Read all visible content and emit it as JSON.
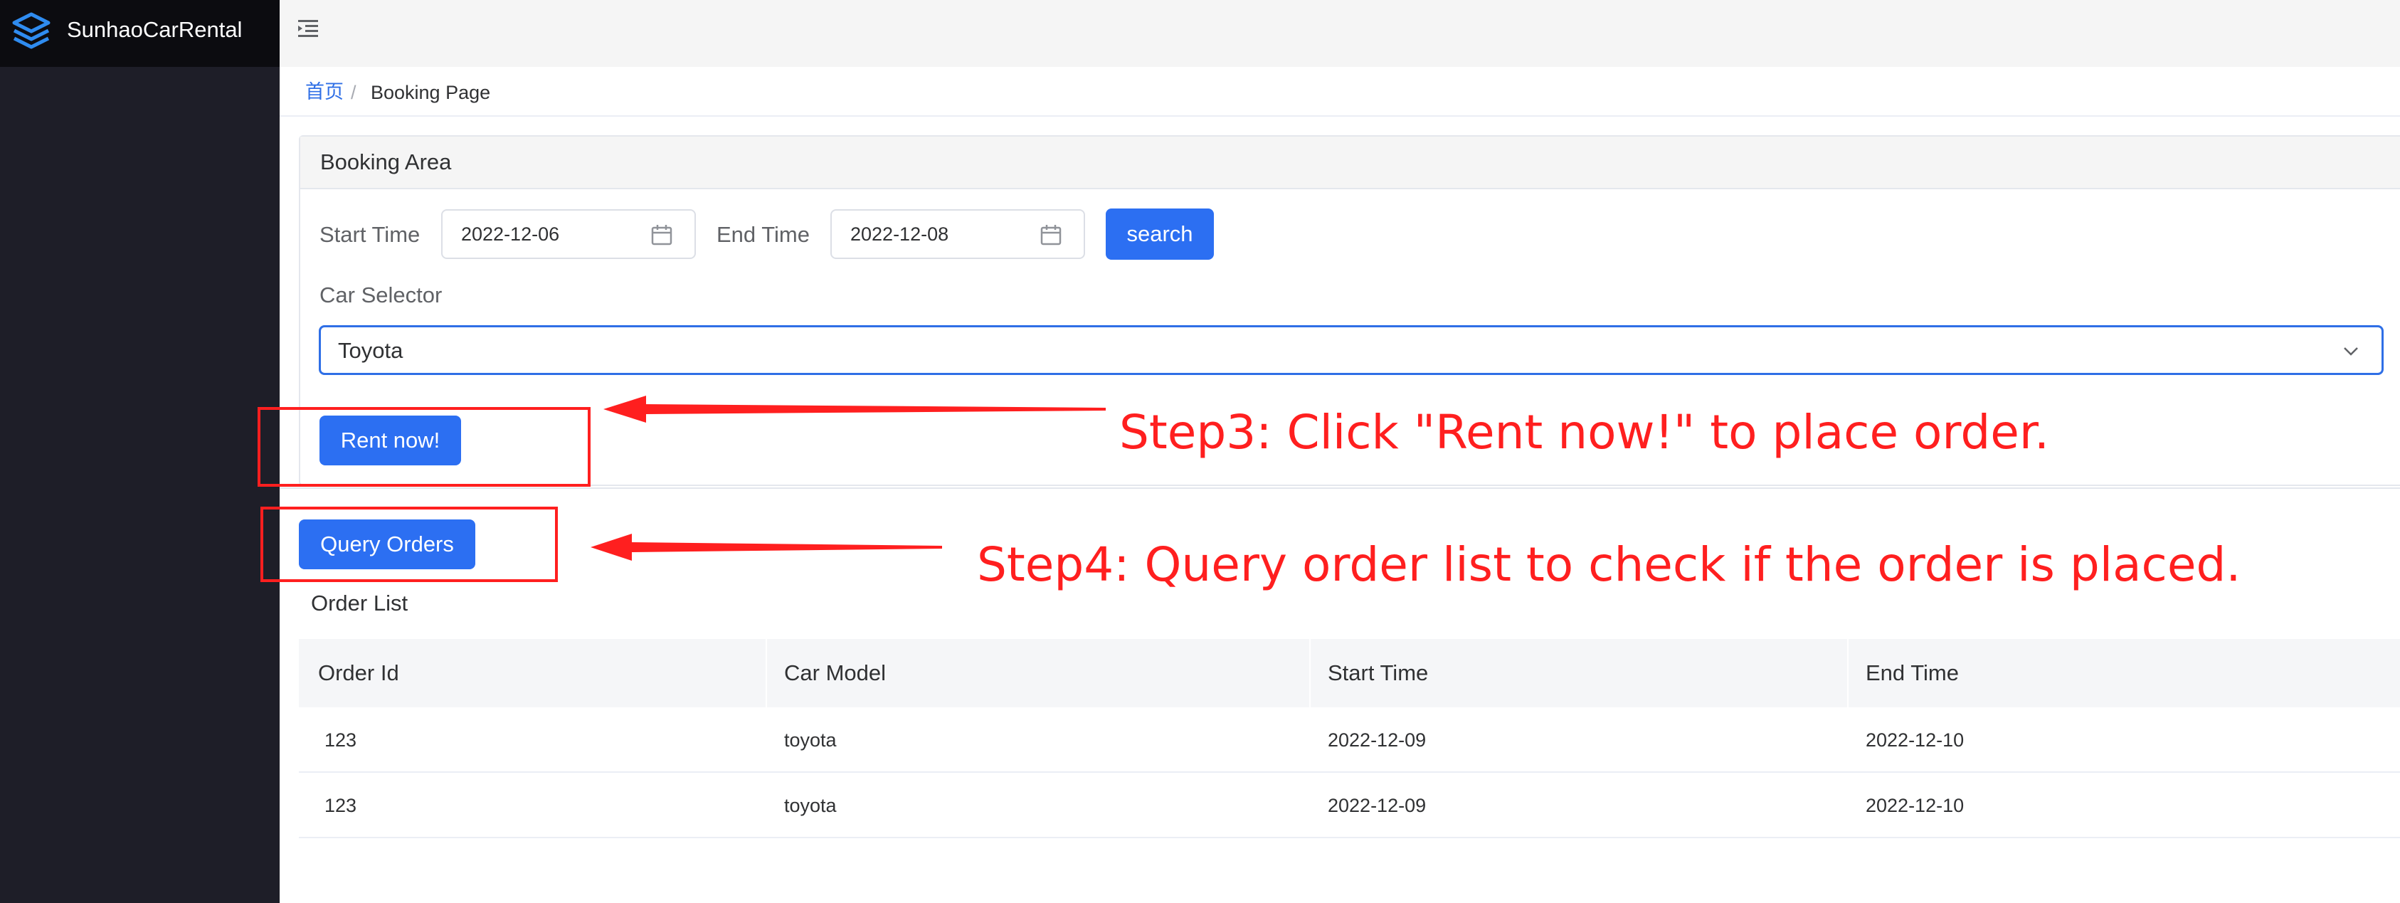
{
  "app": {
    "brand_name": "SunhaoCarRental"
  },
  "breadcrumb": {
    "home": "首页",
    "separator": "/",
    "current": "Booking Page"
  },
  "booking": {
    "title": "Booking Area",
    "start_label": "Start Time",
    "start_value": "2022-12-06",
    "end_label": "End Time",
    "end_value": "2022-12-08",
    "search_label": "search",
    "car_label": "Car Selector",
    "car_value": "Toyota",
    "rent_label": "Rent now!"
  },
  "orders": {
    "query_label": "Query Orders",
    "list_title": "Order List",
    "columns": [
      "Order Id",
      "Car Model",
      "Start Time",
      "End Time"
    ],
    "rows": [
      [
        "123",
        "toyota",
        "2022-12-09",
        "2022-12-10"
      ],
      [
        "123",
        "toyota",
        "2022-12-09",
        "2022-12-10"
      ]
    ]
  },
  "annotations": {
    "step3": "Step3: Click \"Rent now!\" to place order.",
    "step4": "Step4: Query order list to check if the order is placed.",
    "color": "#ff1f1f"
  },
  "colors": {
    "accent": "#2c6ff2",
    "sidebar": "#1e1e28",
    "brand_bar": "#0c0c10"
  },
  "icons": {
    "logo": "layers-logo-icon",
    "fold": "menu-fold-icon",
    "calendar": "calendar-icon",
    "chevron": "chevron-down-icon"
  }
}
